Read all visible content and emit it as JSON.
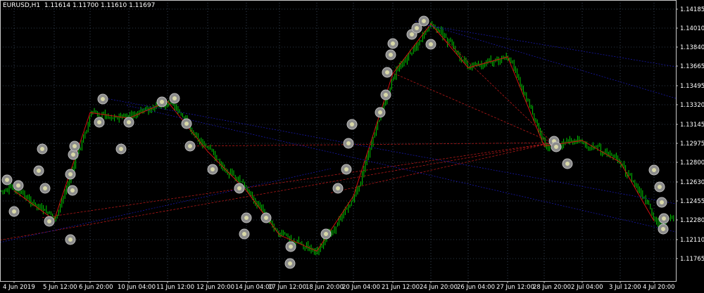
{
  "symbol": {
    "name": "EURUSD,H1",
    "ohlc": "1.11614 1.11700 1.11610 1.11697"
  },
  "price_axis": {
    "labels": [
      "1.14185",
      "1.14010",
      "1.13840",
      "1.13665",
      "1.13495",
      "1.13320",
      "1.13145",
      "1.12975",
      "1.12800",
      "1.12630",
      "1.12455",
      "1.12280",
      "1.12110",
      "1.11765"
    ]
  },
  "time_axis": {
    "labels": [
      "4 Jun 2019",
      "5 Jun 12:00",
      "6 Jun 20:00",
      "10 Jun 04:00",
      "11 Jun 12:00",
      "12 Jun 20:00",
      "14 Jun 04:00",
      "17 Jun 12:00",
      "18 Jun 20:00",
      "20 Jun 04:00",
      "21 Jun 12:00",
      "24 Jun 20:00",
      "26 Jun 04:00",
      "27 Jun 12:00",
      "28 Jun 20:00",
      "2 Jul 04:00",
      "3 Jul 12:00",
      "4 Jul 20:00"
    ]
  },
  "colors": {
    "background": "#000000",
    "grid": "#5a6f8c",
    "candles": "#00c800",
    "zigzag": "#d01010",
    "fan_red": "#b01818",
    "fan_blue": "#1818a8",
    "marker_ring": "#8c8c8c",
    "marker_fill": "#d8d8a8"
  },
  "chart_data": {
    "type": "candlestick",
    "symbol": "EURUSD",
    "timeframe": "H1",
    "ylim": [
      1.117,
      1.1425
    ],
    "approx_close_path": [
      {
        "x": "4 Jun 2019",
        "y": 1.1255
      },
      {
        "x": "5 Jun 12:00",
        "y": 1.1228
      },
      {
        "x": "6 Jun 20:00",
        "y": 1.1325
      },
      {
        "x": "10 Jun 04:00",
        "y": 1.132
      },
      {
        "x": "11 Jun 12:00",
        "y": 1.1335
      },
      {
        "x": "12 Jun 20:00",
        "y": 1.129
      },
      {
        "x": "14 Jun 04:00",
        "y": 1.1255
      },
      {
        "x": "17 Jun 12:00",
        "y": 1.1215
      },
      {
        "x": "18 Jun 20:00",
        "y": 1.119
      },
      {
        "x": "20 Jun 04:00",
        "y": 1.125
      },
      {
        "x": "21 Jun 12:00",
        "y": 1.136
      },
      {
        "x": "24 Jun 20:00",
        "y": 1.1405
      },
      {
        "x": "26 Jun 04:00",
        "y": 1.1365
      },
      {
        "x": "27 Jun 12:00",
        "y": 1.1375
      },
      {
        "x": "28 Jun 20:00",
        "y": 1.1295
      },
      {
        "x": "2 Jul 04:00",
        "y": 1.13
      },
      {
        "x": "3 Jul 12:00",
        "y": 1.128
      },
      {
        "x": "4 Jul 20:00",
        "y": 1.1227
      }
    ]
  }
}
